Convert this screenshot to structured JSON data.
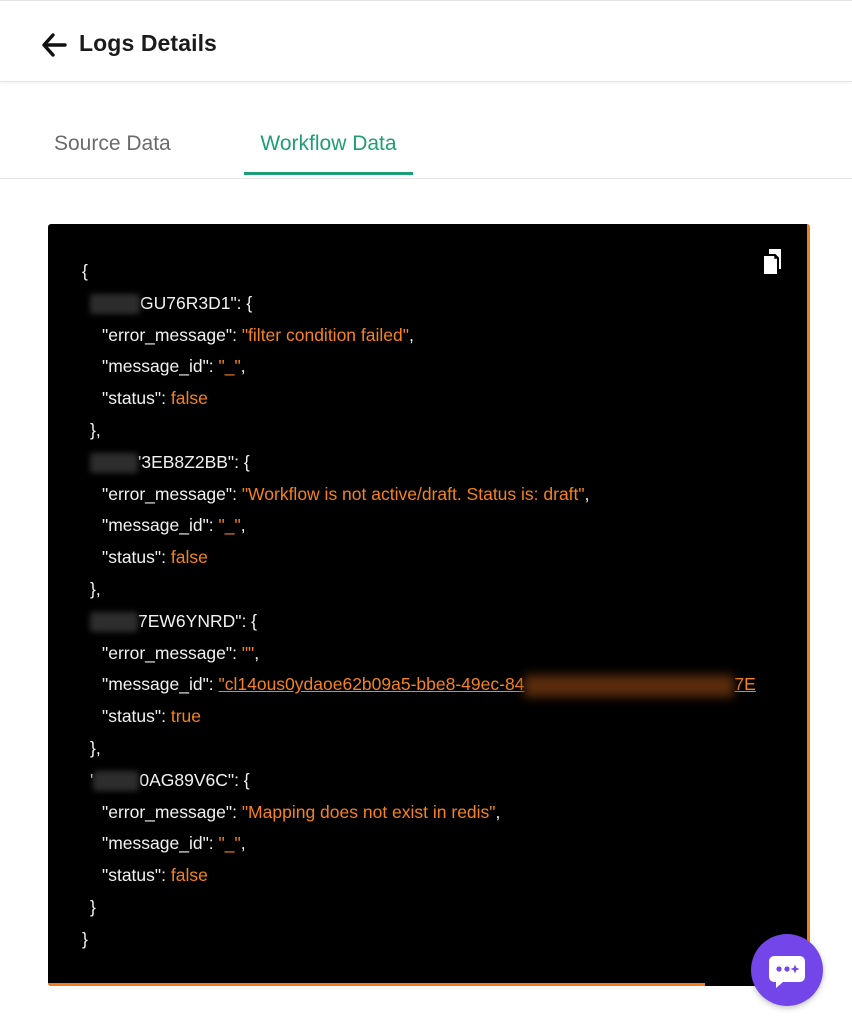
{
  "header": {
    "title": "Logs Details",
    "back_icon": "arrow-left-icon"
  },
  "tabs": [
    {
      "label": "Source Data",
      "active": false
    },
    {
      "label": "Workflow Data",
      "active": true
    }
  ],
  "colors": {
    "accent": "#1e9e75",
    "code_background": "#000000",
    "code_value": "#f7821f",
    "chat_button": "#7246e8"
  },
  "code": {
    "open_brace": "{",
    "close_brace": "}",
    "entries": [
      {
        "key_suffix": "GU76R3D1\": {",
        "error_message_key": "\"error_message\": ",
        "error_message_value": "\"filter condition failed\"",
        "message_id_key": "\"message_id\": ",
        "message_id_value": "\"_\"",
        "status_key": "\"status\": ",
        "status_value": "false",
        "close": "},"
      },
      {
        "key_suffix": "'3EB8Z2BB\": {",
        "error_message_key": "\"error_message\": ",
        "error_message_value": "\"Workflow is not active/draft. Status is: draft\"",
        "message_id_key": "\"message_id\": ",
        "message_id_value": "\"_\"",
        "status_key": "\"status\": ",
        "status_value": "false",
        "close": "},"
      },
      {
        "key_suffix": "7EW6YNRD\": {",
        "error_message_key": "\"error_message\": ",
        "error_message_value": "\"\"",
        "message_id_key": "\"message_id\": ",
        "message_id_value": "\"cl14ous0ydaoe62b09a5-bbe8-49ec-84",
        "message_id_tail": "7E",
        "status_key": "\"status\": ",
        "status_value": "true",
        "close": "},"
      },
      {
        "key_prefix": "'",
        "key_suffix": "0AG89V6C\": {",
        "error_message_key": "\"error_message\": ",
        "error_message_value": "\"Mapping does not exist in redis\"",
        "message_id_key": "\"message_id\": ",
        "message_id_value": "\"_\"",
        "status_key": "\"status\": ",
        "status_value": "false",
        "close": "}"
      }
    ]
  },
  "copy_icon": "copy-icon",
  "chat_icon": "chat-bubble-icon"
}
